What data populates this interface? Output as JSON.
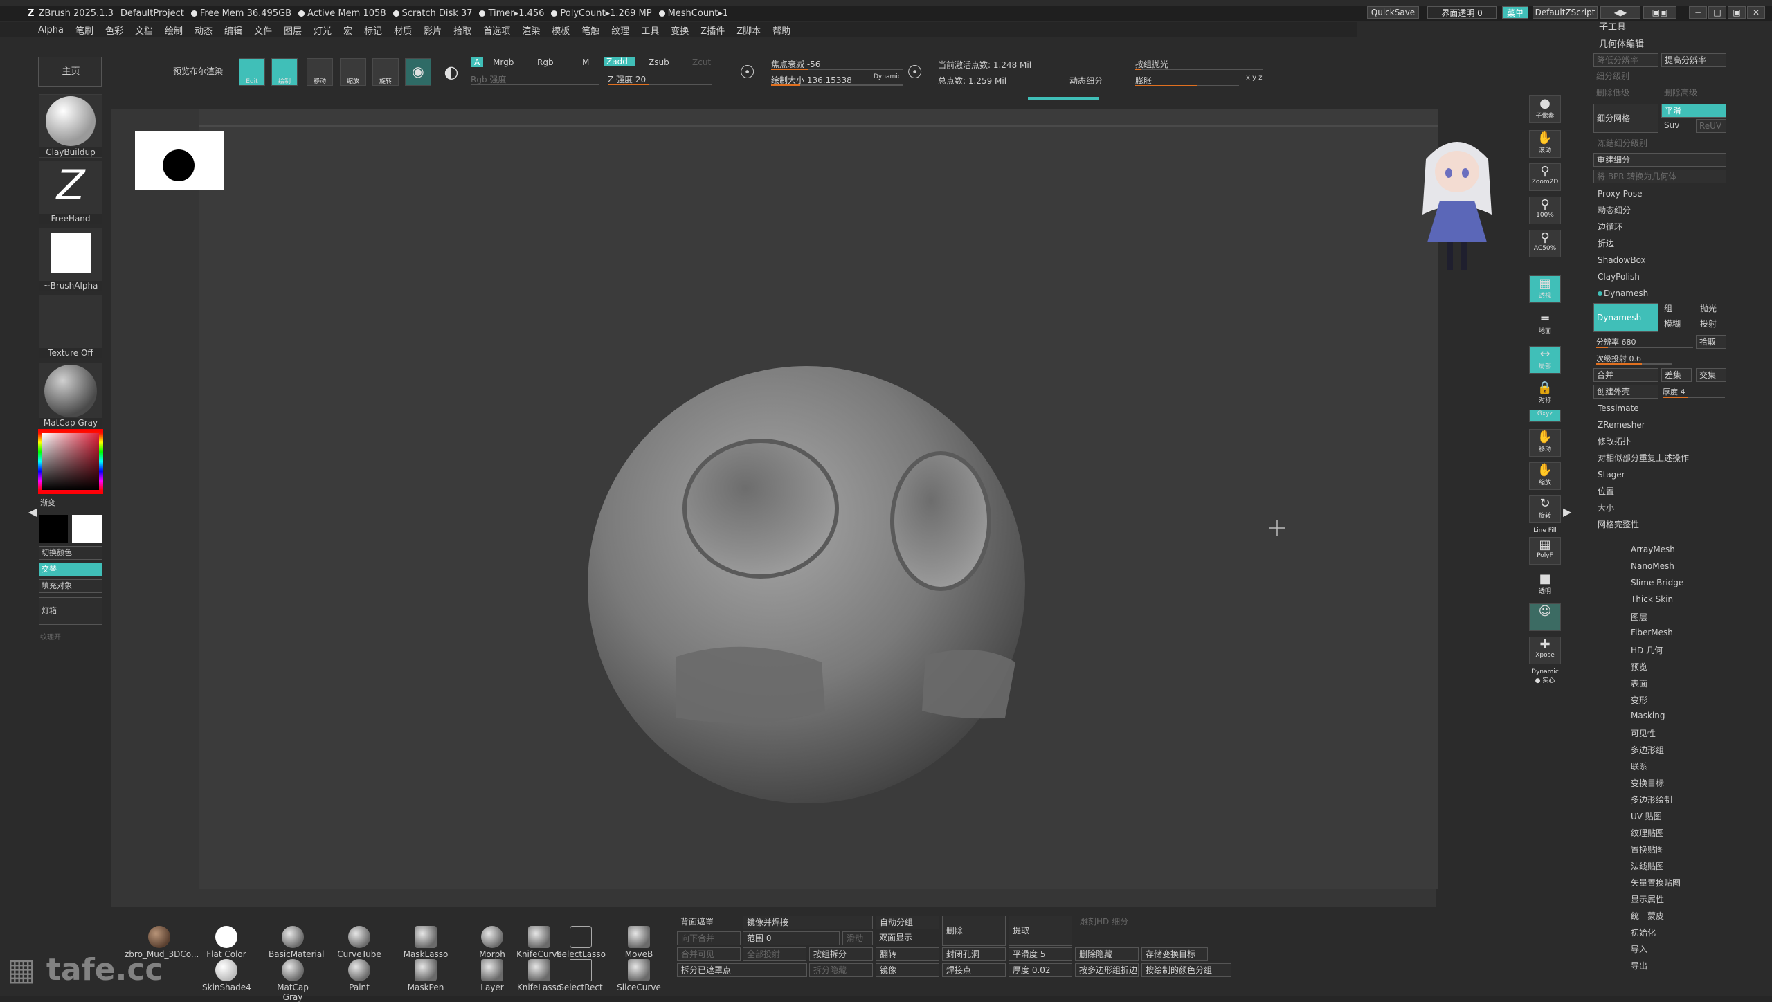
{
  "titlebar": {
    "app": "ZBrush 2025.1.3",
    "project": "DefaultProject",
    "free_mem": "Free Mem 36.495GB",
    "active_mem": "Active Mem 1058",
    "scratch": "Scratch Disk 37",
    "timer": "Timer▸1.456",
    "polycount": "PolyCount▸1.269 MP",
    "meshcount": "MeshCount▸1",
    "quicksave": "QuickSave",
    "transparency": "界面透明 0",
    "menu": "菜单",
    "script": "DefaultZScript"
  },
  "menubar": [
    "Alpha",
    "笔刷",
    "色彩",
    "文档",
    "绘制",
    "动态",
    "编辑",
    "文件",
    "图层",
    "灯光",
    "宏",
    "标记",
    "材质",
    "影片",
    "拾取",
    "首选项",
    "渲染",
    "模板",
    "笔触",
    "纹理",
    "工具",
    "变换",
    "Z插件",
    "Z脚本",
    "帮助"
  ],
  "left": {
    "home": "主页",
    "brush": "ClayBuildup",
    "stroke": "FreeHand",
    "alpha": "~BrushAlpha",
    "texture": "Texture Off",
    "material": "MatCap Gray",
    "gradient": "渐变",
    "switch_color": "切换颜色",
    "alternate": "交替",
    "fill": "填充对象",
    "lightbox": "灯箱",
    "texture_off2": "纹理开"
  },
  "topshelf": {
    "preview_render": "预览布尔渲染",
    "edit": "Edit",
    "draw": "绘制",
    "move": "移动",
    "scale": "缩放",
    "rotate": "旋转",
    "a": "A",
    "mrgb": "Mrgb",
    "rgb": "Rgb",
    "m": "M",
    "zadd": "Zadd",
    "zsub": "Zsub",
    "zcut": "Zcut",
    "rgb_strength": "Rgb 强度",
    "z_strength": "Z 强度 20",
    "focal_shift": "焦点衰减 -56",
    "draw_size": "绘制大小 136.15338",
    "dynamic": "Dynamic",
    "active_points": "当前激活点数: 1.248 Mil",
    "total_points": "总点数: 1.259 Mil",
    "dynamic_subdiv": "动态细分",
    "polish": "按组抛光",
    "inflate": "膨胀",
    "xyz": "x y z"
  },
  "right_tools": [
    "子像素",
    "滚动",
    "Zoom2D",
    "100%",
    "AC50%",
    "透视",
    "地面",
    "局部",
    "对称",
    "Gxyz",
    "移动",
    "缩放",
    "旋转",
    "Line Fill",
    "PolyF",
    "透明",
    "Ghost",
    "Xpose",
    "Dynamic",
    "实心"
  ],
  "rpanel": {
    "header": "子工具",
    "section": "几何体编辑",
    "lower_res": "降低分辨率",
    "higher_res": "提高分辨率",
    "subdiv_level": "细分级别",
    "del_lower": "删除低级",
    "del_higher": "删除高级",
    "divide": "细分网格",
    "smooth": "平滑",
    "suv": "Suv",
    "reuv": "ReUV",
    "freeze_subdiv": "冻结细分级别",
    "rebuild_subdiv": "重建细分",
    "convert_bpr": "将 BPR 转换为几何体",
    "items": [
      "Proxy Pose",
      "动态细分",
      "边循环",
      "折边",
      "ShadowBox",
      "ClayPolish"
    ],
    "dynamesh_title": "Dynamesh",
    "dynamesh_btn": "Dynamesh",
    "group": "组",
    "polish": "抛光",
    "blur": "模糊",
    "project": "投射",
    "resolution": "分辨率 680",
    "extract": "拾取",
    "subproject": "次级投射 0.6",
    "merge": "合并",
    "subtract": "差集",
    "intersect": "交集",
    "create_shell": "创建外壳",
    "thickness": "厚度 4",
    "items2": [
      "Tessimate",
      "ZRemesher",
      "修改拓扑",
      "对相似部分重复上述操作",
      "Stager",
      "位置",
      "大小",
      "网格完整性"
    ],
    "subpalettes": [
      "ArrayMesh",
      "NanoMesh",
      "Slime Bridge",
      "Thick Skin",
      "图层",
      "FiberMesh",
      "HD 几何",
      "预览",
      "表面",
      "变形",
      "Masking",
      "可见性",
      "多边形组",
      "联系",
      "变换目标",
      "多边形绘制",
      "UV 贴图",
      "纹理贴图",
      "置换贴图",
      "法线贴图",
      "矢量置换贴图",
      "显示属性",
      "统一蒙皮",
      "初始化",
      "导入",
      "导出"
    ]
  },
  "bottom": {
    "brushes": [
      "zbro_Mud_3DCo...",
      "Flat Color",
      "BasicMaterial",
      "CurveTube",
      "MaskLasso",
      "Morph",
      "KnifeCurve",
      "SelectLasso",
      "MoveB",
      "SkinShade4",
      "MatCap Gray",
      "Paint",
      "MaskPen",
      "Layer",
      "KnifeLasso",
      "SelectRect",
      "SliceCurve"
    ],
    "buttons": {
      "backface_mask": "背面遮罩",
      "mirror_weld": "镜像并焊接",
      "auto_group": "自动分组",
      "delete": "删除",
      "extract": "提取",
      "merge_down": "向下合并",
      "range": "范围 0",
      "slide": "滑动",
      "double": "双面显示",
      "merge_visible": "合并可见",
      "full_project": "全部投射",
      "split_groups": "按组拆分",
      "flip": "翻转",
      "close_holes": "封闭孔洞",
      "smooth": "平滑度 5",
      "del_hidden": "删除隐藏",
      "store_morph": "存储变换目标",
      "split_masked": "拆分已遮罩点",
      "split_hidden": "拆分隐藏",
      "mirror": "镜像",
      "weld_points": "焊接点",
      "thickness": "厚度 0.02",
      "group_by_normals": "按多边形组折边",
      "group_by_color": "按绘制的颜色分组",
      "hd_subdiv": "雕刻HD 细分"
    }
  },
  "watermark": "tafe.cc",
  "colors": {
    "accent": "#40bfb8",
    "highlight": "#e07020"
  }
}
